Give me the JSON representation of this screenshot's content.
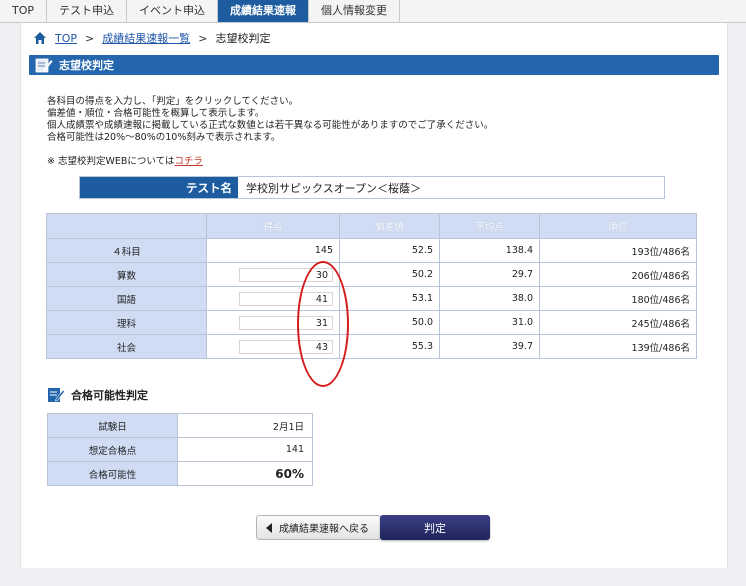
{
  "tabs": [
    {
      "label": "TOP",
      "active": false
    },
    {
      "label": "テスト申込",
      "active": false
    },
    {
      "label": "イベント申込",
      "active": false
    },
    {
      "label": "成績結果速報",
      "active": true
    },
    {
      "label": "個人情報変更",
      "active": false
    }
  ],
  "breadcrumb": {
    "top": "TOP",
    "sep1": ">",
    "list": "成績結果速報一覧",
    "sep2": ">",
    "current": "志望校判定"
  },
  "section_title": "志望校判定",
  "intro": [
    "各科目の得点を入力し、「判定」をクリックしてください。",
    "偏差値・順位・合格可能性を概算して表示します。",
    "個人成績票や成績速報に掲載している正式な数値とは若干異なる可能性がありますのでご了承ください。",
    "合格可能性は20%～80%の10%刻みで表示されます。"
  ],
  "note": {
    "prefix": "※ 志望校判定WEBについては",
    "link": "コチラ"
  },
  "test": {
    "label": "テスト名",
    "value": "学校別サピックスオープン＜桜蔭＞"
  },
  "score_table": {
    "headers": [
      "",
      "得点",
      "偏差値",
      "平均点",
      "順位"
    ],
    "rows": [
      {
        "subject": "４科目",
        "score": "145",
        "deviation": "52.5",
        "average": "138.4",
        "rank": "193位/486名",
        "input": false
      },
      {
        "subject": "算数",
        "score": "30",
        "deviation": "50.2",
        "average": "29.7",
        "rank": "206位/486名",
        "input": true
      },
      {
        "subject": "国語",
        "score": "41",
        "deviation": "53.1",
        "average": "38.0",
        "rank": "180位/486名",
        "input": true
      },
      {
        "subject": "理科",
        "score": "31",
        "deviation": "50.0",
        "average": "31.0",
        "rank": "245位/486名",
        "input": true
      },
      {
        "subject": "社会",
        "score": "43",
        "deviation": "55.3",
        "average": "39.7",
        "rank": "139位/486名",
        "input": true
      }
    ]
  },
  "pass_section": {
    "title": "合格可能性判定",
    "rows": [
      {
        "label": "試験日",
        "value": "2月1日"
      },
      {
        "label": "想定合格点",
        "value": "141"
      },
      {
        "label": "合格可能性",
        "value": "60%"
      }
    ]
  },
  "buttons": {
    "back": "成績結果速報へ戻る",
    "judge": "判定"
  },
  "colors": {
    "accent": "#1d5c9e",
    "header_cell": "#cfdcf3",
    "judge_button": "#2a2f6e",
    "annotation": "#d61c1c"
  },
  "icons": {
    "home": "home-icon",
    "section": "pencil-note-icon",
    "back": "triangle-left-icon"
  }
}
